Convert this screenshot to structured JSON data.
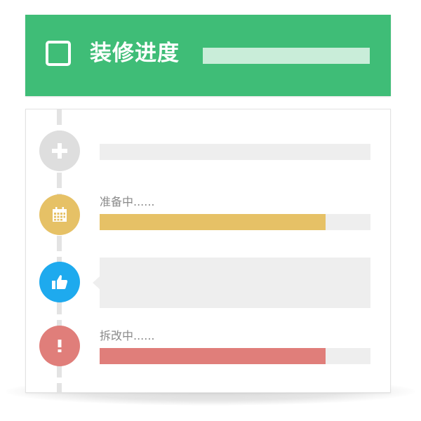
{
  "header": {
    "title": "装修进度",
    "color": "#3fbd77"
  },
  "timeline": {
    "items": [
      {
        "icon": "plus-icon",
        "color": "#dedede",
        "label": ""
      },
      {
        "icon": "calendar-icon",
        "color": "#e6c166",
        "label": "准备中......",
        "progress": 0.835,
        "bar_color": "#e6c166"
      },
      {
        "icon": "thumbs-up-icon",
        "color": "#1eaaee",
        "label": ""
      },
      {
        "icon": "exclamation-icon",
        "color": "#e07e7a",
        "label": "拆改中......",
        "progress": 0.835,
        "bar_color": "#e07e7a"
      }
    ]
  }
}
